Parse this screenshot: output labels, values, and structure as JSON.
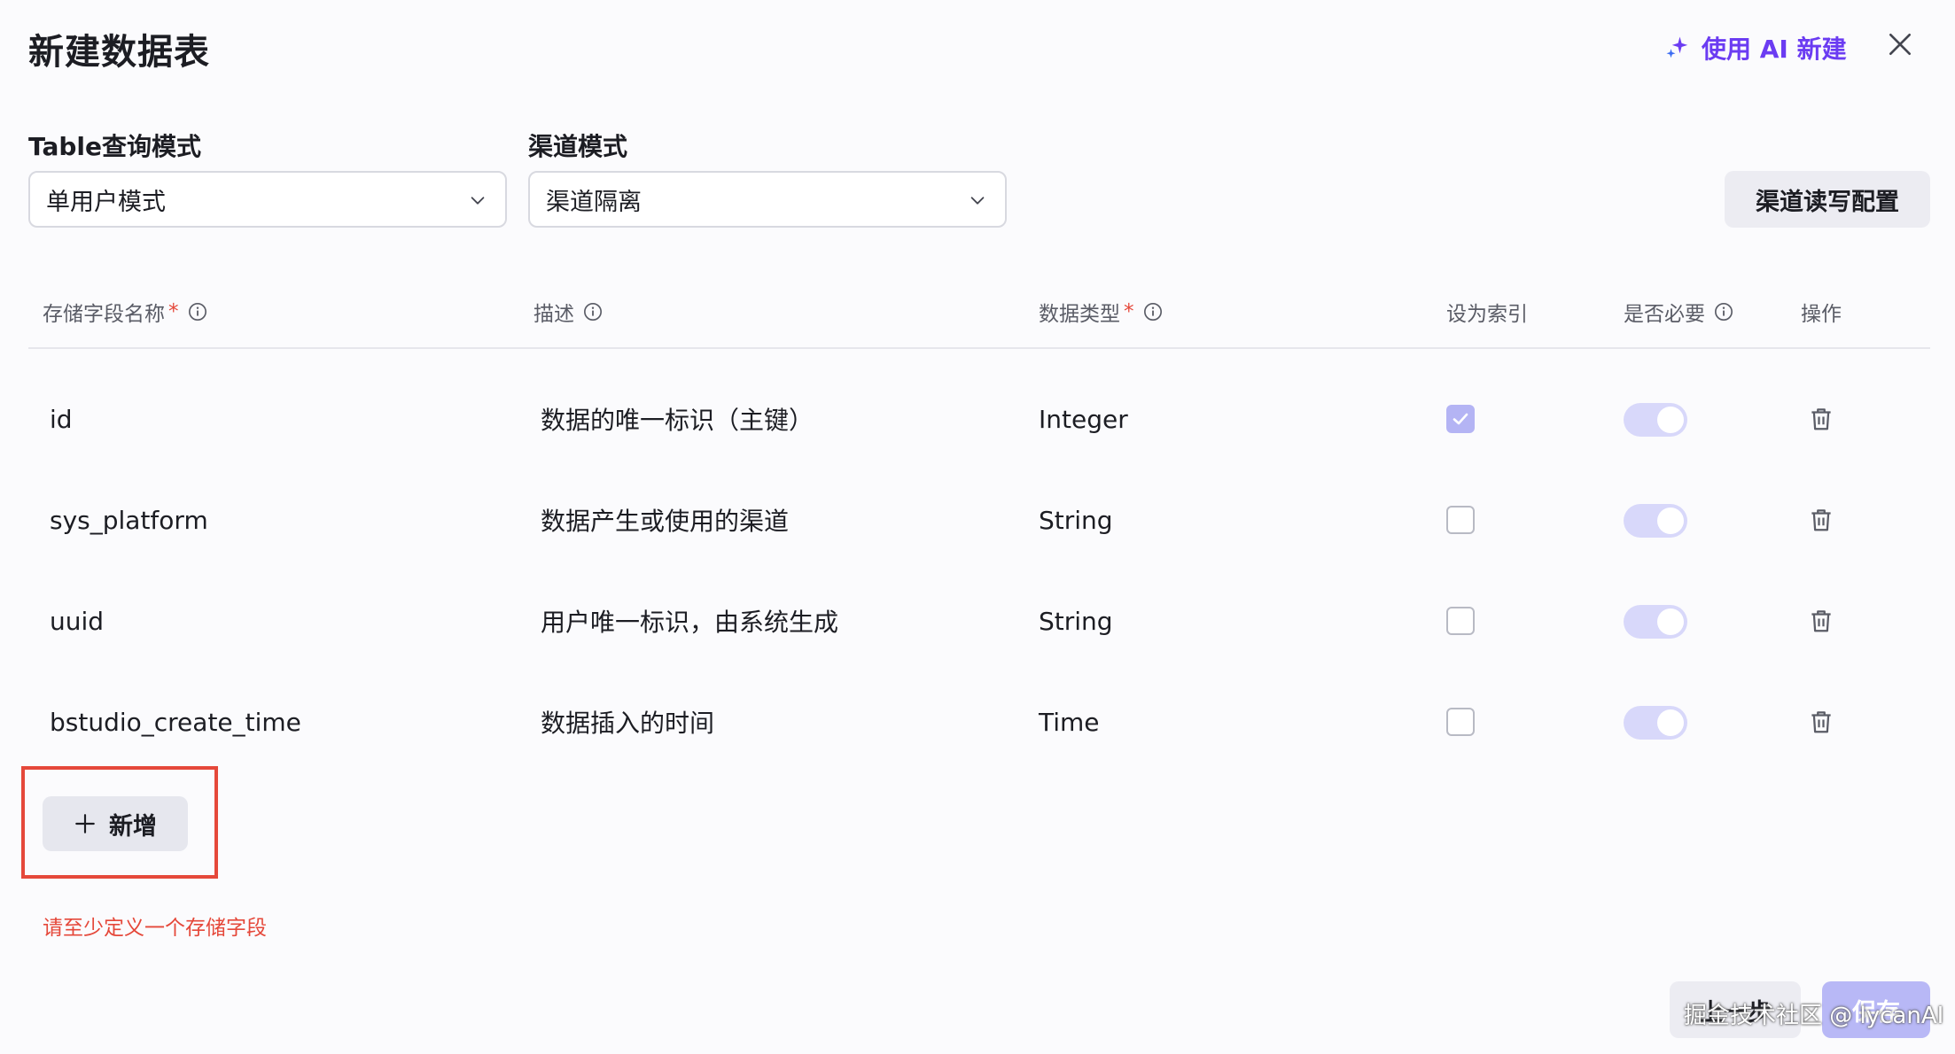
{
  "dialog": {
    "title": "新建数据表",
    "ai_button_label": "使用 AI 新建",
    "accent_color": "#6b3cf2",
    "error_color": "#e5483a"
  },
  "form": {
    "query_mode_label": "Table查询模式",
    "query_mode_value": "单用户模式",
    "channel_mode_label": "渠道模式",
    "channel_mode_value": "渠道隔离",
    "channel_config_button": "渠道读写配置"
  },
  "table": {
    "headers": {
      "field_name": "存储字段名称",
      "description": "描述",
      "data_type": "数据类型",
      "index": "设为索引",
      "required": "是否必要",
      "actions": "操作"
    },
    "required_mark": "*",
    "rows": [
      {
        "name": "id",
        "description": "数据的唯一标识（主键）",
        "type": "Integer",
        "index_checked": true,
        "required_on": true
      },
      {
        "name": "sys_platform",
        "description": "数据产生或使用的渠道",
        "type": "String",
        "index_checked": false,
        "required_on": true
      },
      {
        "name": "uuid",
        "description": "用户唯一标识，由系统生成",
        "type": "String",
        "index_checked": false,
        "required_on": true
      },
      {
        "name": "bstudio_create_time",
        "description": "数据插入的时间",
        "type": "Time",
        "index_checked": false,
        "required_on": true
      }
    ]
  },
  "add_button_label": "新增",
  "error_message": "请至少定义一个存储字段",
  "footer": {
    "prev_button": "上一步",
    "save_button": "保存"
  },
  "watermark": "掘金技术社区 @ lycanAI"
}
